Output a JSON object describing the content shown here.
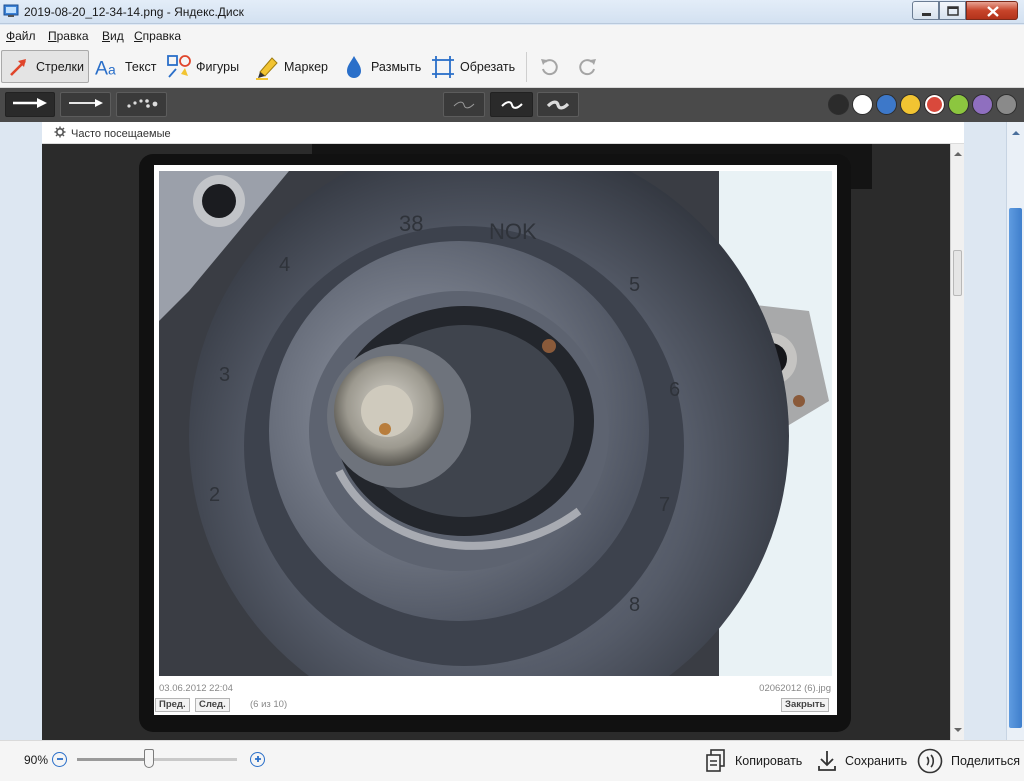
{
  "window": {
    "title": "2019-08-20_12-34-14.png - Яндекс.Диск",
    "colors": {
      "titlebar": "#d8e5f3",
      "close": "#c7442a"
    }
  },
  "menu": [
    {
      "label": "Файл",
      "mnemonic": "Ф"
    },
    {
      "label": "Правка",
      "mnemonic": "П"
    },
    {
      "label": "Вид",
      "mnemonic": "В"
    },
    {
      "label": "Справка",
      "mnemonic": "С"
    }
  ],
  "toolbar": {
    "arrows": "Стрелки",
    "text": "Текст",
    "shapes": "Фигуры",
    "marker": "Маркер",
    "blur": "Размыть",
    "crop": "Обрезать",
    "active_tool": "arrows",
    "icons": [
      "arrow-icon",
      "text-icon",
      "shapes-icon",
      "marker-icon",
      "blur-drop-icon",
      "crop-icon",
      "undo-icon",
      "redo-icon"
    ]
  },
  "stylebar": {
    "arrow_styles": [
      "arrow-thick-icon",
      "arrow-thin-icon",
      "arrow-dotted-icon"
    ],
    "line_weights": [
      "thin",
      "medium",
      "thick"
    ],
    "selected_weight": "medium",
    "colors": [
      "#2b2b2b",
      "#ffffff",
      "#3d78c9",
      "#f2c432",
      "#d9493c",
      "#8cc63f",
      "#8f6fbf",
      "#8a8a8a"
    ],
    "selected_color": "#d9493c"
  },
  "browser": {
    "bookmarks_label": "Часто посещаемые"
  },
  "lightbox": {
    "date": "03.06.2012 22:04",
    "filename": "02062012 (6).jpg",
    "prev": "Пред.",
    "next": "След.",
    "counter": "(6 из 10)",
    "close": "Закрыть"
  },
  "bottombar": {
    "zoom": "90%",
    "zoom_level": 0.45,
    "copy": "Копировать",
    "save": "Сохранить",
    "share": "Поделиться"
  }
}
